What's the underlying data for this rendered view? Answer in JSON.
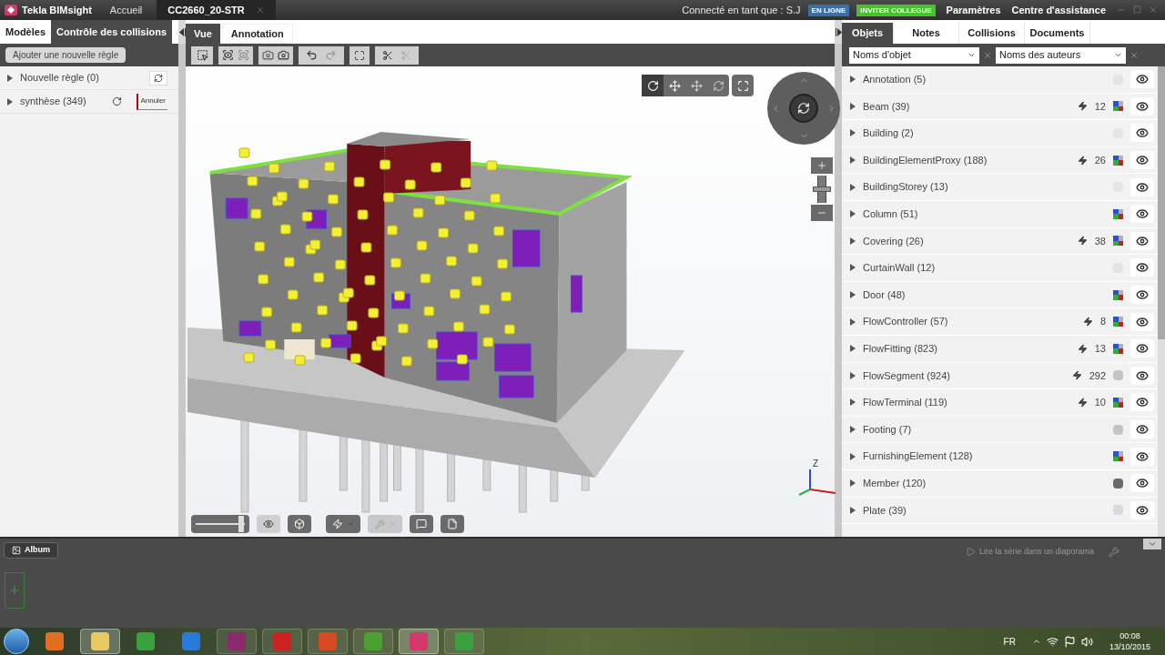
{
  "title_bar": {
    "app_name": "Tekla BIMsight",
    "tabs": [
      {
        "label": "Accueil",
        "selected": false
      },
      {
        "label": "CC2660_20-STR",
        "selected": true
      }
    ],
    "user_label": "Connecté en tant que : S.J",
    "status_badge": "EN LIGNE",
    "invite_button": "INVITER COLLEGUE",
    "links": [
      "Paramètres",
      "Centre d'assistance"
    ]
  },
  "left_panel": {
    "tabs": [
      {
        "label": "Modèles",
        "selected": false
      },
      {
        "label": "Contrôle des collisions",
        "selected": true
      }
    ],
    "add_rule_button": "Ajouter une nouvelle règle",
    "rules": [
      {
        "label": "Nouvelle règle (0)",
        "kind": "idle"
      },
      {
        "label": "synthèse (349)",
        "kind": "running",
        "cancel_label": "Annuler"
      }
    ]
  },
  "viewport": {
    "tabs": [
      {
        "label": "Vue",
        "selected": true
      },
      {
        "label": "Annotation",
        "selected": false
      }
    ],
    "axis_label": "Z",
    "zoom_slider": {
      "level": 0.5
    },
    "transparency_slider": {
      "level": 0.93
    }
  },
  "right_panel": {
    "tabs": [
      {
        "label": "Objets",
        "selected": true
      },
      {
        "label": "Notes",
        "selected": false
      },
      {
        "label": "Collisions",
        "selected": false
      },
      {
        "label": "Documents",
        "selected": false
      }
    ],
    "filters": [
      {
        "value": "Noms d'objet"
      },
      {
        "value": "Noms des auteurs"
      }
    ],
    "objects": [
      {
        "label": "Annotation (5)",
        "kind": "blank"
      },
      {
        "label": "Beam (39)",
        "collisions": "12",
        "kind": "multi"
      },
      {
        "label": "Building (2)",
        "kind": "blank"
      },
      {
        "label": "BuildingElementProxy (188)",
        "collisions": "26",
        "kind": "multi"
      },
      {
        "label": "BuildingStorey (13)",
        "kind": "blank"
      },
      {
        "label": "Column (51)",
        "kind": "multi"
      },
      {
        "label": "Covering (26)",
        "collisions": "38",
        "kind": "multi"
      },
      {
        "label": "CurtainWall (12)",
        "kind": "blank"
      },
      {
        "label": "Door (48)",
        "kind": "multi"
      },
      {
        "label": "FlowController (57)",
        "collisions": "8",
        "kind": "multi"
      },
      {
        "label": "FlowFitting (823)",
        "collisions": "13",
        "kind": "multi"
      },
      {
        "label": "FlowSegment (924)",
        "collisions": "292",
        "kind": "gray"
      },
      {
        "label": "FlowTerminal (119)",
        "collisions": "10",
        "kind": "multi"
      },
      {
        "label": "Footing (7)",
        "kind": "gray"
      },
      {
        "label": "FurnishingElement (128)",
        "kind": "multi"
      },
      {
        "label": "Member (120)",
        "kind": "dark"
      },
      {
        "label": "Plate (39)",
        "kind": "light"
      }
    ]
  },
  "album": {
    "button": "Album",
    "slideshow_label": "Lire la série dans un diaporama"
  },
  "taskbar": {
    "language": "FR",
    "time": "00:08",
    "date": "13/10/2015"
  }
}
